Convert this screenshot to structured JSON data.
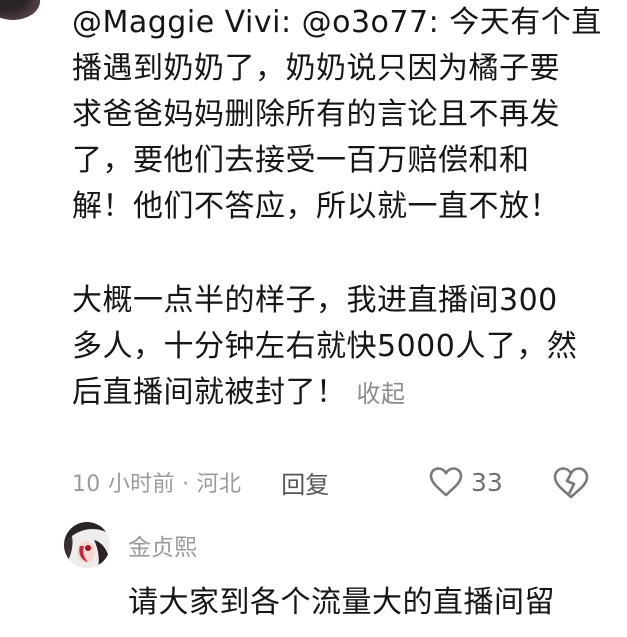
{
  "comment": {
    "paragraph1": [
      "@Maggie Vivi: @o3o77: 今天有个直",
      "播遇到奶奶了，奶奶说只因为橘子要",
      "求爸爸妈妈删除所有的言论且不再发",
      "了，要他们去接受一百万赔偿和和",
      "解！他们不答应，所以就一直不放！"
    ],
    "paragraph2": [
      "大概一点半的样子，我进直播间300",
      "多人，十分钟左右就快5000人了，然",
      "后直播间就被封了！"
    ],
    "collapse_label": "收起",
    "meta": {
      "time": "10 小时前 · 河北",
      "reply_label": "回复",
      "like_count": "33",
      "like_icon": "heart-outline-icon",
      "dislike_icon": "broken-heart-icon"
    }
  },
  "sub_comment": {
    "username": "金贞熙",
    "text": "请大家到各个流量大的直播间留"
  },
  "colors": {
    "text_primary": "#161616",
    "text_secondary": "#9a9a9a",
    "icon_gray": "#8a8a8a"
  }
}
